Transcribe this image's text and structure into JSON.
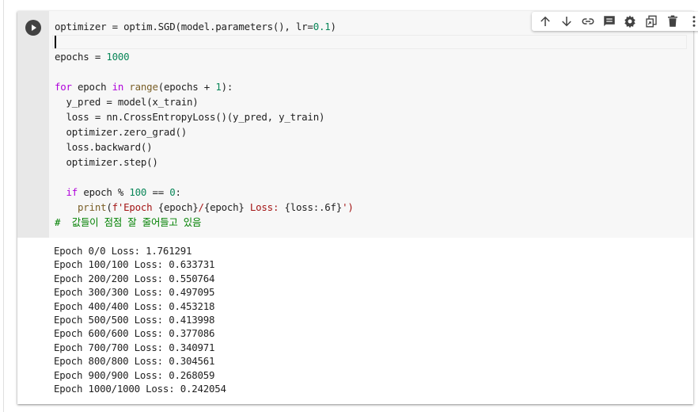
{
  "code_cell": {
    "lines": [
      [
        {
          "t": "optimizer = optim.SGD(model.parameters(), lr="
        },
        {
          "t": "0.1",
          "c": "num"
        },
        {
          "t": ")"
        }
      ],
      [],
      [
        {
          "t": "epochs = "
        },
        {
          "t": "1000",
          "c": "num"
        }
      ],
      [],
      [
        {
          "t": "for",
          "c": "kw"
        },
        {
          "t": " epoch "
        },
        {
          "t": "in",
          "c": "kw"
        },
        {
          "t": " "
        },
        {
          "t": "range",
          "c": "bi"
        },
        {
          "t": "(epochs + "
        },
        {
          "t": "1",
          "c": "num"
        },
        {
          "t": "):"
        }
      ],
      [
        {
          "t": "  y_pred = model(x_train)"
        }
      ],
      [
        {
          "t": "  loss = nn.CrossEntropyLoss()(y_pred, y_train)"
        }
      ],
      [
        {
          "t": "  optimizer.zero_grad()"
        }
      ],
      [
        {
          "t": "  loss.backward()"
        }
      ],
      [
        {
          "t": "  optimizer.step()"
        }
      ],
      [],
      [
        {
          "t": "  "
        },
        {
          "t": "if",
          "c": "kw"
        },
        {
          "t": " epoch % "
        },
        {
          "t": "100",
          "c": "num"
        },
        {
          "t": " == "
        },
        {
          "t": "0",
          "c": "num"
        },
        {
          "t": ":"
        }
      ],
      [
        {
          "t": "    "
        },
        {
          "t": "print",
          "c": "bi"
        },
        {
          "t": "("
        },
        {
          "t": "f'Epoch ",
          "c": "str"
        },
        {
          "t": "{epoch}"
        },
        {
          "t": "/",
          "c": "str"
        },
        {
          "t": "{epoch}"
        },
        {
          "t": " Loss: ",
          "c": "str"
        },
        {
          "t": "{loss:.6f}"
        },
        {
          "t": "')",
          "c": "str"
        }
      ],
      [
        {
          "t": "#  값들이 점점 잘 줄어들고 있음",
          "c": "cm"
        }
      ]
    ]
  },
  "output": {
    "lines": [
      "Epoch 0/0 Loss: 1.761291",
      "Epoch 100/100 Loss: 0.633731",
      "Epoch 200/200 Loss: 0.550764",
      "Epoch 300/300 Loss: 0.497095",
      "Epoch 400/400 Loss: 0.453218",
      "Epoch 500/500 Loss: 0.413998",
      "Epoch 600/600 Loss: 0.377086",
      "Epoch 700/700 Loss: 0.340971",
      "Epoch 800/800 Loss: 0.304561",
      "Epoch 900/900 Loss: 0.268059",
      "Epoch 1000/1000 Loss: 0.242054"
    ]
  },
  "toolbar": {
    "icons": [
      "arrow-up-icon",
      "arrow-down-icon",
      "link-icon",
      "comment-icon",
      "gear-icon",
      "mirror-cell-icon",
      "trash-icon",
      "more-vert-icon"
    ]
  },
  "colors": {
    "keyword": "#af00db",
    "builtin": "#795e26",
    "number": "#098658",
    "string": "#a31515",
    "comment": "#008000"
  }
}
